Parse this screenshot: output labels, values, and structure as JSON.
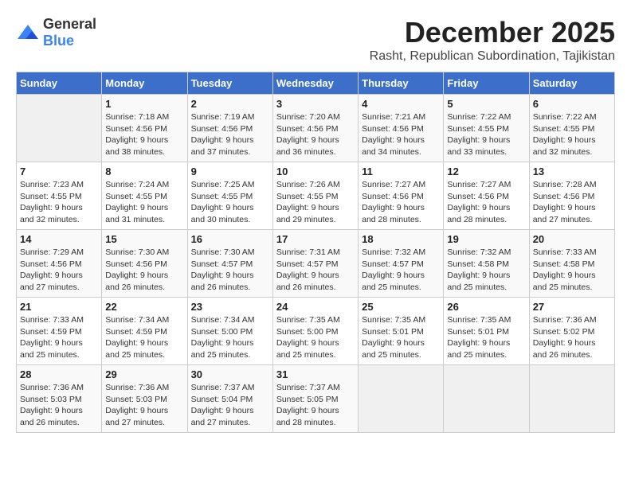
{
  "header": {
    "logo_general": "General",
    "logo_blue": "Blue",
    "month_title": "December 2025",
    "subtitle": "Rasht, Republican Subordination, Tajikistan"
  },
  "weekdays": [
    "Sunday",
    "Monday",
    "Tuesday",
    "Wednesday",
    "Thursday",
    "Friday",
    "Saturday"
  ],
  "weeks": [
    [
      {
        "day": "",
        "sunrise": "",
        "sunset": "",
        "daylight": ""
      },
      {
        "day": "1",
        "sunrise": "Sunrise: 7:18 AM",
        "sunset": "Sunset: 4:56 PM",
        "daylight": "Daylight: 9 hours and 38 minutes."
      },
      {
        "day": "2",
        "sunrise": "Sunrise: 7:19 AM",
        "sunset": "Sunset: 4:56 PM",
        "daylight": "Daylight: 9 hours and 37 minutes."
      },
      {
        "day": "3",
        "sunrise": "Sunrise: 7:20 AM",
        "sunset": "Sunset: 4:56 PM",
        "daylight": "Daylight: 9 hours and 36 minutes."
      },
      {
        "day": "4",
        "sunrise": "Sunrise: 7:21 AM",
        "sunset": "Sunset: 4:56 PM",
        "daylight": "Daylight: 9 hours and 34 minutes."
      },
      {
        "day": "5",
        "sunrise": "Sunrise: 7:22 AM",
        "sunset": "Sunset: 4:55 PM",
        "daylight": "Daylight: 9 hours and 33 minutes."
      },
      {
        "day": "6",
        "sunrise": "Sunrise: 7:22 AM",
        "sunset": "Sunset: 4:55 PM",
        "daylight": "Daylight: 9 hours and 32 minutes."
      }
    ],
    [
      {
        "day": "7",
        "sunrise": "Sunrise: 7:23 AM",
        "sunset": "Sunset: 4:55 PM",
        "daylight": "Daylight: 9 hours and 32 minutes."
      },
      {
        "day": "8",
        "sunrise": "Sunrise: 7:24 AM",
        "sunset": "Sunset: 4:55 PM",
        "daylight": "Daylight: 9 hours and 31 minutes."
      },
      {
        "day": "9",
        "sunrise": "Sunrise: 7:25 AM",
        "sunset": "Sunset: 4:55 PM",
        "daylight": "Daylight: 9 hours and 30 minutes."
      },
      {
        "day": "10",
        "sunrise": "Sunrise: 7:26 AM",
        "sunset": "Sunset: 4:55 PM",
        "daylight": "Daylight: 9 hours and 29 minutes."
      },
      {
        "day": "11",
        "sunrise": "Sunrise: 7:27 AM",
        "sunset": "Sunset: 4:56 PM",
        "daylight": "Daylight: 9 hours and 28 minutes."
      },
      {
        "day": "12",
        "sunrise": "Sunrise: 7:27 AM",
        "sunset": "Sunset: 4:56 PM",
        "daylight": "Daylight: 9 hours and 28 minutes."
      },
      {
        "day": "13",
        "sunrise": "Sunrise: 7:28 AM",
        "sunset": "Sunset: 4:56 PM",
        "daylight": "Daylight: 9 hours and 27 minutes."
      }
    ],
    [
      {
        "day": "14",
        "sunrise": "Sunrise: 7:29 AM",
        "sunset": "Sunset: 4:56 PM",
        "daylight": "Daylight: 9 hours and 27 minutes."
      },
      {
        "day": "15",
        "sunrise": "Sunrise: 7:30 AM",
        "sunset": "Sunset: 4:56 PM",
        "daylight": "Daylight: 9 hours and 26 minutes."
      },
      {
        "day": "16",
        "sunrise": "Sunrise: 7:30 AM",
        "sunset": "Sunset: 4:57 PM",
        "daylight": "Daylight: 9 hours and 26 minutes."
      },
      {
        "day": "17",
        "sunrise": "Sunrise: 7:31 AM",
        "sunset": "Sunset: 4:57 PM",
        "daylight": "Daylight: 9 hours and 26 minutes."
      },
      {
        "day": "18",
        "sunrise": "Sunrise: 7:32 AM",
        "sunset": "Sunset: 4:57 PM",
        "daylight": "Daylight: 9 hours and 25 minutes."
      },
      {
        "day": "19",
        "sunrise": "Sunrise: 7:32 AM",
        "sunset": "Sunset: 4:58 PM",
        "daylight": "Daylight: 9 hours and 25 minutes."
      },
      {
        "day": "20",
        "sunrise": "Sunrise: 7:33 AM",
        "sunset": "Sunset: 4:58 PM",
        "daylight": "Daylight: 9 hours and 25 minutes."
      }
    ],
    [
      {
        "day": "21",
        "sunrise": "Sunrise: 7:33 AM",
        "sunset": "Sunset: 4:59 PM",
        "daylight": "Daylight: 9 hours and 25 minutes."
      },
      {
        "day": "22",
        "sunrise": "Sunrise: 7:34 AM",
        "sunset": "Sunset: 4:59 PM",
        "daylight": "Daylight: 9 hours and 25 minutes."
      },
      {
        "day": "23",
        "sunrise": "Sunrise: 7:34 AM",
        "sunset": "Sunset: 5:00 PM",
        "daylight": "Daylight: 9 hours and 25 minutes."
      },
      {
        "day": "24",
        "sunrise": "Sunrise: 7:35 AM",
        "sunset": "Sunset: 5:00 PM",
        "daylight": "Daylight: 9 hours and 25 minutes."
      },
      {
        "day": "25",
        "sunrise": "Sunrise: 7:35 AM",
        "sunset": "Sunset: 5:01 PM",
        "daylight": "Daylight: 9 hours and 25 minutes."
      },
      {
        "day": "26",
        "sunrise": "Sunrise: 7:35 AM",
        "sunset": "Sunset: 5:01 PM",
        "daylight": "Daylight: 9 hours and 25 minutes."
      },
      {
        "day": "27",
        "sunrise": "Sunrise: 7:36 AM",
        "sunset": "Sunset: 5:02 PM",
        "daylight": "Daylight: 9 hours and 26 minutes."
      }
    ],
    [
      {
        "day": "28",
        "sunrise": "Sunrise: 7:36 AM",
        "sunset": "Sunset: 5:03 PM",
        "daylight": "Daylight: 9 hours and 26 minutes."
      },
      {
        "day": "29",
        "sunrise": "Sunrise: 7:36 AM",
        "sunset": "Sunset: 5:03 PM",
        "daylight": "Daylight: 9 hours and 27 minutes."
      },
      {
        "day": "30",
        "sunrise": "Sunrise: 7:37 AM",
        "sunset": "Sunset: 5:04 PM",
        "daylight": "Daylight: 9 hours and 27 minutes."
      },
      {
        "day": "31",
        "sunrise": "Sunrise: 7:37 AM",
        "sunset": "Sunset: 5:05 PM",
        "daylight": "Daylight: 9 hours and 28 minutes."
      },
      {
        "day": "",
        "sunrise": "",
        "sunset": "",
        "daylight": ""
      },
      {
        "day": "",
        "sunrise": "",
        "sunset": "",
        "daylight": ""
      },
      {
        "day": "",
        "sunrise": "",
        "sunset": "",
        "daylight": ""
      }
    ]
  ]
}
